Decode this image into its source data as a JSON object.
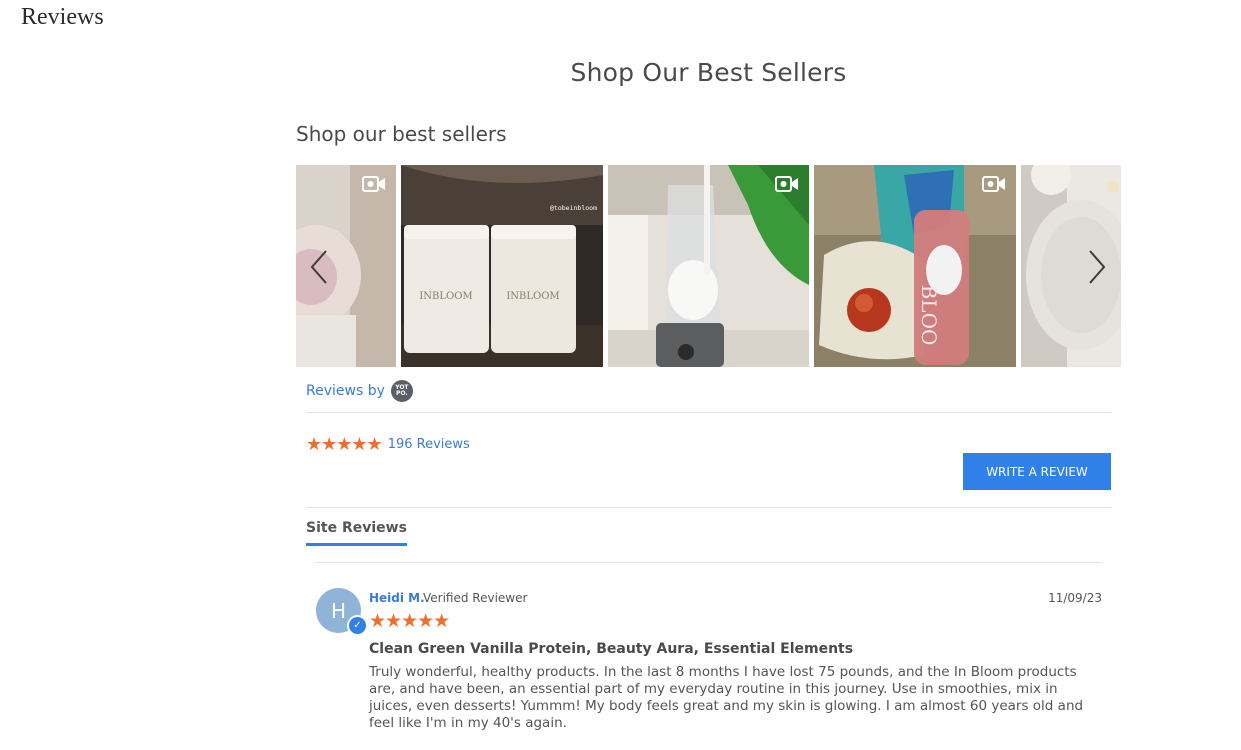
{
  "page": {
    "heading": "Reviews"
  },
  "section": {
    "title": "Shop Our Best Sellers"
  },
  "carousel": {
    "title": "Shop our best sellers",
    "tiles": [
      {
        "name": "tile-1",
        "video": true
      },
      {
        "name": "tile-2",
        "video": false,
        "handle": "@tobeinbloom",
        "jar_brand": "INBLOOM"
      },
      {
        "name": "tile-3",
        "video": true
      },
      {
        "name": "tile-4",
        "video": true,
        "bottle_text": "BLOO"
      },
      {
        "name": "tile-5",
        "video": false
      }
    ],
    "prev_icon": "chevron-left-icon",
    "next_icon": "chevron-right-icon"
  },
  "reviews_by": {
    "label": "Reviews by",
    "logo_text": "YOT PO."
  },
  "summary": {
    "rating": 5,
    "stars": "★★★★★",
    "count_label": "196 Reviews"
  },
  "write_review": {
    "label": "WRITE A REVIEW"
  },
  "tabs": {
    "site_reviews": "Site Reviews"
  },
  "review": {
    "avatar_initial": "H",
    "name": "Heidi M.",
    "verified": "Verified Reviewer",
    "date": "11/09/23",
    "stars": "★★★★★",
    "rating": 5,
    "title": "Clean Green Vanilla Protein, Beauty Aura, Essential Elements",
    "body": "Truly wonderful, healthy products. In the last 8 months I have lost 75 pounds, and the In Bloom products are, and have been, an essential part of my everyday routine in this journey. Use in smoothies, mix in juices, even desserts! Yummm! My body feels great and my skin is glowing. I am almost 60 years old and feel like I'm in my 40's again."
  },
  "colors": {
    "accent": "#2f80e7",
    "star": "#e9712f",
    "link": "#3a7bd5"
  }
}
